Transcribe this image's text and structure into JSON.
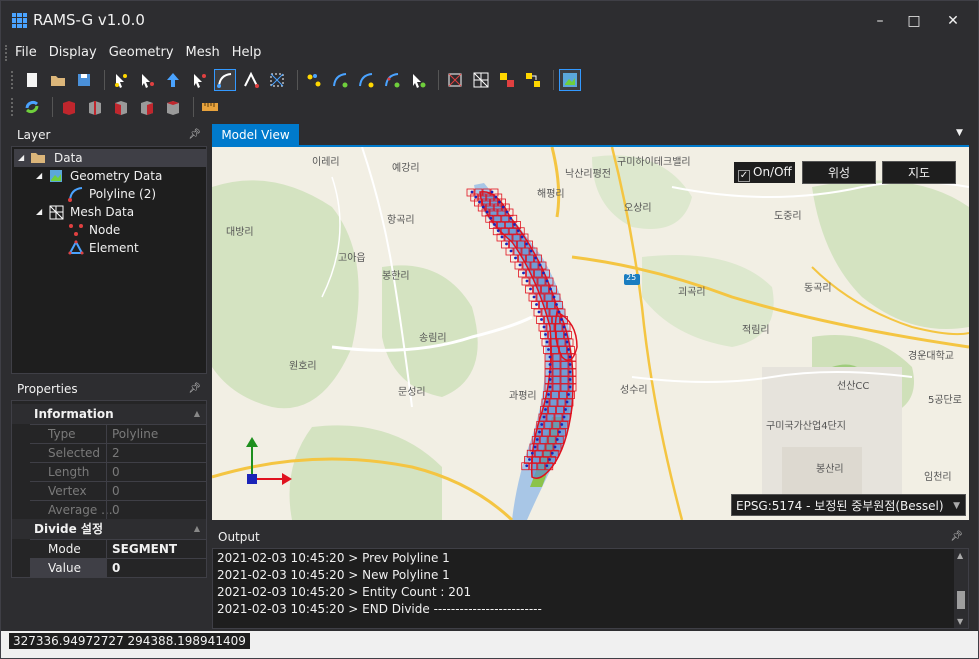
{
  "app": {
    "title": "RAMS-G v1.0.0"
  },
  "window_controls": {
    "minimize": "–",
    "maximize": "□",
    "close": "✕"
  },
  "menu": [
    "File",
    "Display",
    "Geometry",
    "Mesh",
    "Help"
  ],
  "layer_panel": {
    "title": "Layer",
    "tree": [
      {
        "label": "Data",
        "level": 0,
        "icon": "folder-icon",
        "expanded": true,
        "selected": true
      },
      {
        "label": "Geometry Data",
        "level": 1,
        "icon": "geometry-icon",
        "expanded": true
      },
      {
        "label": "Polyline (2)",
        "level": 2,
        "icon": "polyline-icon"
      },
      {
        "label": "Mesh Data",
        "level": 1,
        "icon": "mesh-icon",
        "expanded": true
      },
      {
        "label": "Node",
        "level": 2,
        "icon": "node-icon"
      },
      {
        "label": "Element",
        "level": 2,
        "icon": "element-icon"
      }
    ]
  },
  "properties_panel": {
    "title": "Properties",
    "groups": [
      {
        "name": "Information",
        "rows": [
          {
            "key": "Type",
            "value": "Polyline"
          },
          {
            "key": "Selected",
            "value": "2"
          },
          {
            "key": "Length",
            "value": "0"
          },
          {
            "key": "Vertex",
            "value": "0"
          },
          {
            "key": "Average ...",
            "value": "0"
          }
        ]
      },
      {
        "name": "Divide 설정",
        "rows": [
          {
            "key": "Mode",
            "value": "SEGMENT"
          },
          {
            "key": "Value",
            "value": "0"
          }
        ]
      }
    ]
  },
  "model_view": {
    "tab_label": "Model View",
    "onoff_label": "On/Off",
    "onoff_checked": true,
    "satellite_button": "위성",
    "map_button": "지도",
    "crs_select": "EPSG:5174 - 보정된 중부원점(Bessel)"
  },
  "map_labels": [
    "이레리",
    "예강리",
    "낙산리평전",
    "구미하이테크밸리",
    "오상리",
    "항곡리",
    "해평리",
    "도중리",
    "대방리",
    "고아읍",
    "봉한리",
    "괴곡리",
    "동곡리",
    "송림리",
    "적림리",
    "경운대학교",
    "원호리",
    "문성리",
    "성수리",
    "선산CC",
    "과평리",
    "구미국가산업4단지",
    "5공단로",
    "봉산리",
    "임천리",
    "25"
  ],
  "output_panel": {
    "title": "Output",
    "lines": [
      "2021-02-03 10:45:20 > Prev Polyline 1",
      "2021-02-03 10:45:20 > New Polyline 1",
      "2021-02-03 10:45:20 > Entity Count : 201",
      "2021-02-03 10:45:20 > END Divide -------------------------"
    ]
  },
  "status": {
    "coordinates": "327336.94972727 294388.198941409"
  },
  "colors": {
    "accent": "#007acc",
    "river": "#8fb0d8",
    "mesh": "#e0121f",
    "node": "#1a24b8"
  }
}
